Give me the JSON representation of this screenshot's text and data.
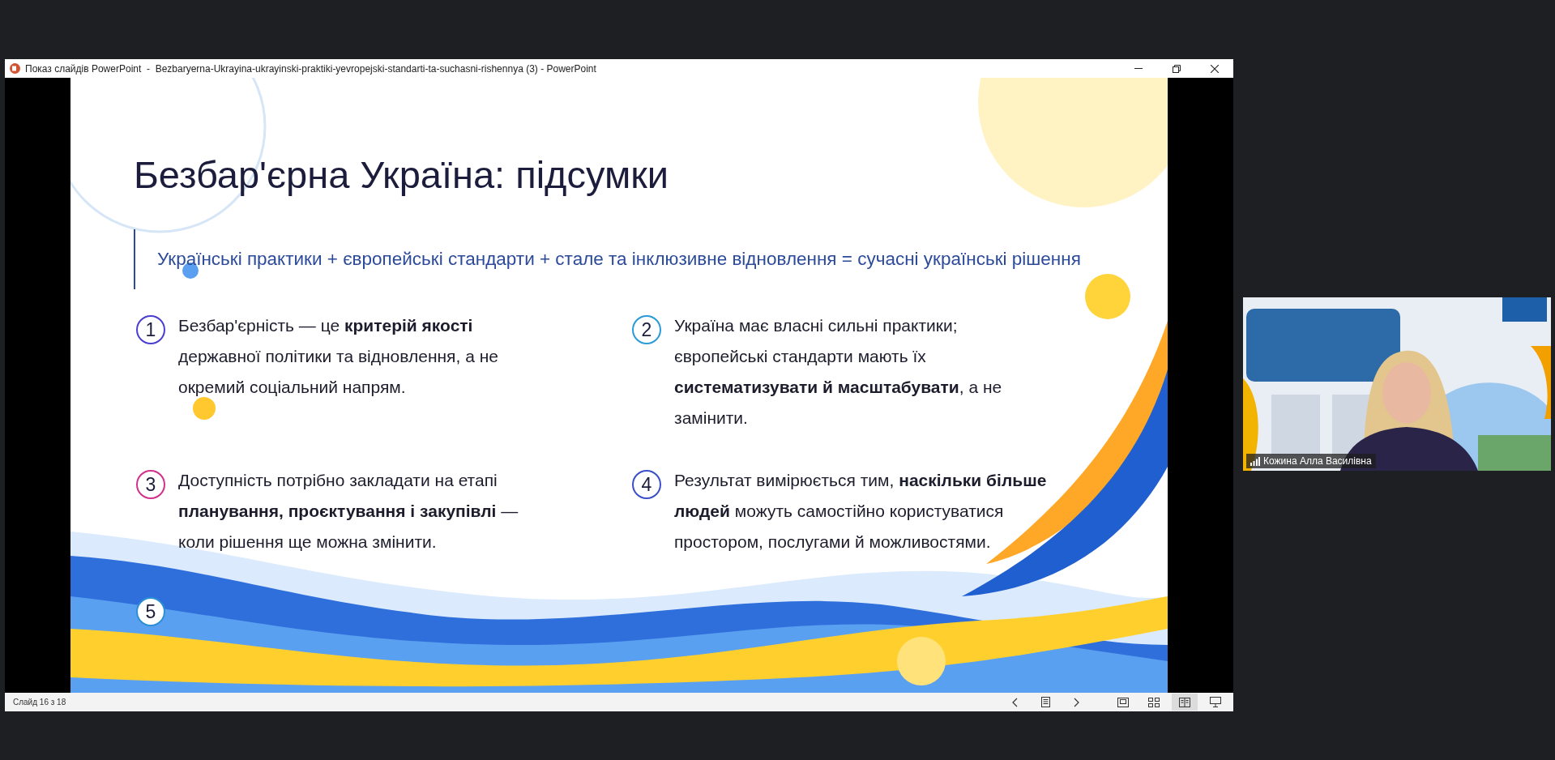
{
  "window": {
    "title": "Показ слайдів PowerPoint  -  Bezbaryerna-Ukrayina-ukrayinski-praktiki-yevropejski-standarti-ta-suchasni-rishennya (3) - PowerPoint"
  },
  "slide": {
    "title": "Безбар'єрна Україна: підсумки",
    "subtitle": "Українські практики + європейські стандарти + стале та інклюзивне відновлення = сучасні українські рішення",
    "points": [
      {
        "number": "1",
        "color": "#4b3fd1",
        "text": "Безбар'єрність — це **критерій якості** державної політики та відновлення, а не окремий соціальний напрям."
      },
      {
        "number": "2",
        "color": "#2b9ad8",
        "text": "Україна має власні сильні практики; європейські стандарти мають їх **систематизувати й масштабувати**, а не замінити."
      },
      {
        "number": "3",
        "color": "#d3308c",
        "text": "Доступність потрібно закладати на етапі **планування, проєктування і закупівлі** — коли рішення ще можна змінити."
      },
      {
        "number": "4",
        "color": "#3a4fc9",
        "text": "Результат вимірюється тим, **наскільки більше людей** можуть самостійно користуватися простором, послугами й можливостями."
      },
      {
        "number": "5",
        "color": "#2b8fd6"
      }
    ]
  },
  "status_bar": {
    "slide_counter": "Слайд 16 з 18",
    "view_buttons": [
      {
        "kind": "normal",
        "selected": false
      },
      {
        "kind": "sorter",
        "selected": false
      },
      {
        "kind": "reading",
        "selected": true
      },
      {
        "kind": "slideshow",
        "selected": false
      }
    ]
  },
  "video": {
    "kind": "picture",
    "participant_name": "Кожина Алла Василівна"
  }
}
